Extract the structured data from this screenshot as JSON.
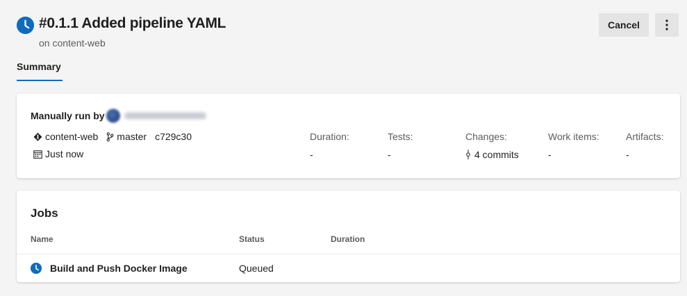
{
  "header": {
    "title": "#0.1.1 Added pipeline YAML",
    "subtitle": "on content-web",
    "status_icon": "clock-icon",
    "cancel_label": "Cancel",
    "more_icon": "more-vertical-icon"
  },
  "tabs": [
    {
      "label": "Summary",
      "selected": true
    }
  ],
  "summary": {
    "manual_run_label": "Manually run by",
    "repository": "content-web",
    "branch": "master",
    "commit": "c729c30",
    "time": "Just now",
    "stats": [
      {
        "label": "Duration:",
        "value": "-"
      },
      {
        "label": "Tests:",
        "value": "-"
      },
      {
        "label": "Changes:",
        "value": "4 commits"
      },
      {
        "label": "Work items:",
        "value": "-"
      },
      {
        "label": "Artifacts:",
        "value": "-"
      }
    ]
  },
  "jobs": {
    "title": "Jobs",
    "columns": [
      "Name",
      "Status",
      "Duration"
    ],
    "rows": [
      {
        "name": "Build and Push Docker Image",
        "status": "Queued",
        "duration": ""
      }
    ]
  },
  "colors": {
    "accent": "#0f6cbd",
    "background": "#f4f4f4",
    "card": "#ffffff"
  }
}
